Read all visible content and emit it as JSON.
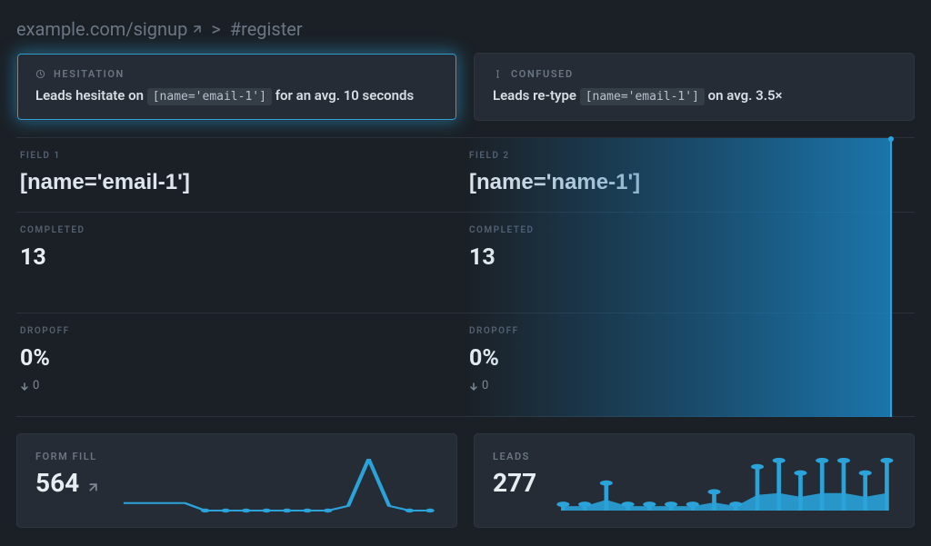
{
  "breadcrumb": {
    "path": "example.com/signup",
    "anchor": "#register",
    "separator": ">"
  },
  "insights": {
    "hesitation": {
      "title": "HESITATION",
      "prefix": "Leads hesitate on",
      "field": "[name='email-1']",
      "suffix": "for an avg. 10 seconds"
    },
    "confused": {
      "title": "CONFUSED",
      "prefix": "Leads re-type",
      "field": "[name='email-1']",
      "suffix": "on avg. 3.5×"
    }
  },
  "fields": [
    {
      "label": "FIELD 1",
      "name": "[name='email-1']",
      "completed_label": "COMPLETED",
      "completed": "13",
      "dropoff_label": "DROPOFF",
      "dropoff": "0%",
      "dropoff_delta": "0"
    },
    {
      "label": "FIELD 2",
      "name": "[name='name-1']",
      "completed_label": "COMPLETED",
      "completed": "13",
      "dropoff_label": "DROPOFF",
      "dropoff": "0%",
      "dropoff_delta": "0"
    }
  ],
  "tiles": {
    "form_fill": {
      "label": "FORM FILL",
      "value": "564"
    },
    "leads": {
      "label": "LEADS",
      "value": "277"
    }
  },
  "chart_data": [
    {
      "type": "line",
      "title": "FORM FILL",
      "x": [
        0,
        1,
        2,
        3,
        4,
        5,
        6,
        7,
        8,
        9,
        10,
        11,
        12,
        13,
        14,
        15
      ],
      "values": [
        8,
        8,
        8,
        8,
        0,
        0,
        0,
        0,
        0,
        0,
        0,
        5,
        55,
        5,
        0,
        0
      ],
      "ylim": [
        0,
        60
      ]
    },
    {
      "type": "line",
      "title": "LEADS",
      "x": [
        0,
        1,
        2,
        3,
        4,
        5,
        6,
        7,
        8,
        9,
        10,
        11,
        12,
        13,
        14,
        15
      ],
      "values": [
        5,
        5,
        22,
        5,
        5,
        5,
        5,
        15,
        5,
        35,
        40,
        30,
        40,
        40,
        30,
        40
      ],
      "ylim": [
        0,
        45
      ]
    }
  ]
}
